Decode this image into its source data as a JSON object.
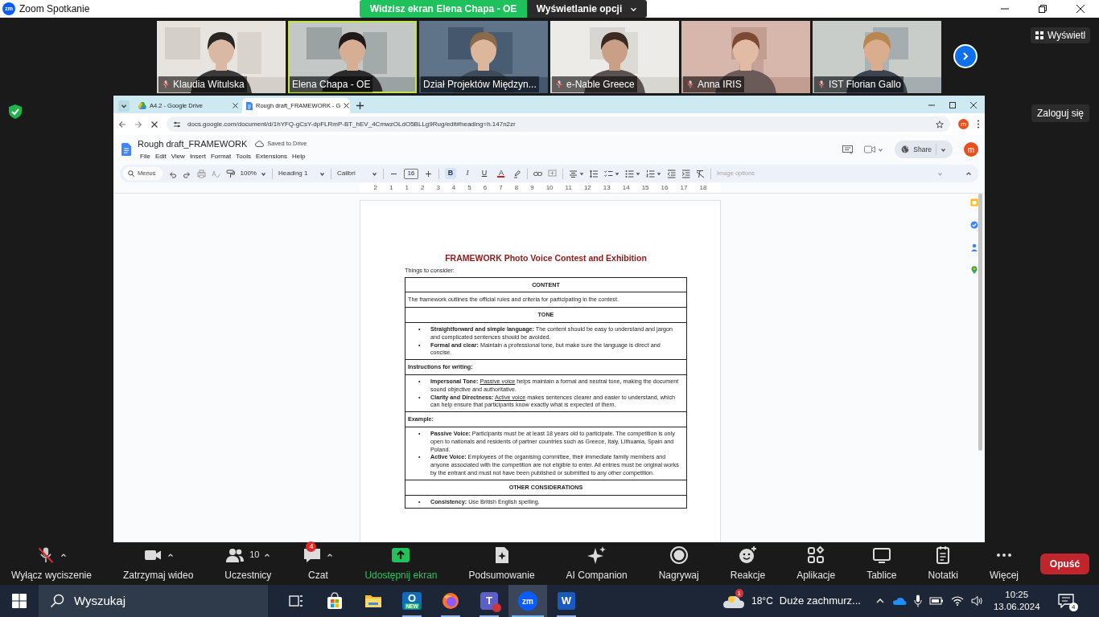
{
  "window": {
    "logo": "zm",
    "title": "Zoom Spotkanie"
  },
  "share_banner": {
    "status": "Widzisz ekran Elena Chapa - OE",
    "options": "Wyświetlanie opcji"
  },
  "participants": [
    {
      "name": "Klaudia Witulska",
      "muted": true,
      "active": false
    },
    {
      "name": "Elena Chapa - OE",
      "muted": false,
      "active": true
    },
    {
      "name": "Dział Projektów Międzyn...",
      "muted": false,
      "active": false
    },
    {
      "name": "e-Nable Greece",
      "muted": true,
      "active": false
    },
    {
      "name": "Anna IRIS",
      "muted": true,
      "active": false
    },
    {
      "name": "IST Florian Gallo",
      "muted": true,
      "active": false
    }
  ],
  "view_button": "Wyświetl",
  "sign_in_button": "Zaloguj się",
  "browser": {
    "tabs": [
      {
        "title": "A4.2 - Google Drive",
        "kind": "drive",
        "selected": false
      },
      {
        "title": "Rough draft_FRAMEWORK - G",
        "kind": "docs",
        "selected": true
      }
    ],
    "url": "docs.google.com/document/d/1hYFQ-gCsY-dpFLRmP-BT_hEV_4CmwzOLdO5BLLg9Rug/edit#heading=h.147n2zr",
    "profile": "m"
  },
  "docs": {
    "title": "Rough draft_FRAMEWORK",
    "status": "Saved to Drive",
    "menu": [
      "File",
      "Edit",
      "View",
      "Insert",
      "Format",
      "Tools",
      "Extensions",
      "Help"
    ],
    "share": "Share",
    "avatar": "m",
    "toolbar": {
      "search": "Menus",
      "zoom": "100%",
      "style": "Heading 1",
      "font": "Calibri",
      "font_size": "16",
      "format": [
        {
          "label": "B",
          "selected": true
        },
        {
          "label": "I",
          "selected": false
        },
        {
          "label": "U",
          "selected": false
        }
      ],
      "text_color": "A",
      "image_options": "Image options"
    },
    "ruler": [
      "2",
      "1",
      "1",
      "2",
      "3",
      "4",
      "5",
      "6",
      "7",
      "8",
      "9",
      "10",
      "11",
      "12",
      "13",
      "14",
      "15",
      "16",
      "17",
      "18"
    ]
  },
  "document": {
    "heading": "FRAMEWORK Photo Voice Contest and Exhibition",
    "intro": "Things to consider:",
    "rows": [
      {
        "kind": "header",
        "text": "CONTENT"
      },
      {
        "kind": "text",
        "text": "The framework outlines the official rules and criteria for participating in the contest."
      },
      {
        "kind": "header",
        "text": "TONE"
      },
      {
        "kind": "bullets",
        "marker": "•",
        "items": [
          {
            "term": "Straightforward and simple language:",
            "text": "The content should be easy to understand and jargon and complicated sentences should be avoided."
          },
          {
            "term": "Formal and clear:",
            "text": "Maintain a professional tone, but make sure the language is direct and concise."
          }
        ]
      },
      {
        "kind": "label",
        "text": "Instructions for writing:"
      },
      {
        "kind": "bullets",
        "marker": "•",
        "items": [
          {
            "term": "Impersonal Tone:",
            "underlined": "Passive voice",
            "text": "helps maintain a formal and neutral tone, making the document sound objective and authoritative."
          },
          {
            "term": "Clarity and Directness:",
            "underlined": "Active voice",
            "text": "makes sentences clearer and easier to understand, which can help ensure that participants know exactly what is expected of them."
          }
        ]
      },
      {
        "kind": "label",
        "text": "Example:"
      },
      {
        "kind": "bullets",
        "marker": "•",
        "items": [
          {
            "term": "Passive Voice:",
            "text": "Participants must be at least 18 years old to participate. The competition is only open to nationals and residents of partner countries such as Greece, Italy, Lithuania, Spain and Poland."
          },
          {
            "term": "Active Voice:",
            "text": "Employees of the organising committee, their immediate family members and anyone associated with the competition are not eligible to enter. All entries must be original works by the entrant and must not have been published or submitted to any other competition."
          }
        ]
      },
      {
        "kind": "header",
        "text": "OTHER CONSIDERATIONS"
      },
      {
        "kind": "bullets",
        "marker": "•",
        "items": [
          {
            "term": "Consistency:",
            "text": "Use British English spelling."
          }
        ]
      }
    ]
  },
  "meeting_controls": [
    {
      "kind": "mic",
      "label": "Wyłącz wyciszenie",
      "caret": true
    },
    {
      "kind": "video",
      "label": "Zatrzymaj wideo",
      "caret": true
    },
    {
      "kind": "participants",
      "label": "Uczestnicy",
      "count": "10",
      "caret": true
    },
    {
      "kind": "chat",
      "label": "Czat",
      "badge": "4",
      "caret": true
    },
    {
      "kind": "share",
      "label": "Udostępnij ekran",
      "caret": false
    },
    {
      "kind": "summary",
      "label": "Podsumowanie",
      "caret": false
    },
    {
      "kind": "companion",
      "label": "AI Companion",
      "caret": false
    },
    {
      "kind": "record",
      "label": "Nagrywaj",
      "caret": false
    },
    {
      "kind": "reactions",
      "label": "Reakcje",
      "caret": false
    },
    {
      "kind": "apps",
      "label": "Aplikacje",
      "caret": false
    },
    {
      "kind": "whiteboards",
      "label": "Tablice",
      "caret": false
    },
    {
      "kind": "notes",
      "label": "Notatki",
      "caret": false
    },
    {
      "kind": "more",
      "label": "Więcej",
      "caret": false
    }
  ],
  "leave_button": "Opuść",
  "taskbar": {
    "search": "Wyszukaj",
    "apps": [
      {
        "kind": "taskview",
        "running": false,
        "selected": false
      },
      {
        "kind": "store",
        "running": false,
        "selected": false
      },
      {
        "kind": "explorer",
        "running": false,
        "selected": false
      },
      {
        "kind": "outlook",
        "label": "O",
        "tag": "NEW",
        "running": true,
        "selected": false
      },
      {
        "kind": "firefox",
        "running": true,
        "selected": false
      },
      {
        "kind": "teams",
        "label": "T",
        "running": true,
        "selected": false
      },
      {
        "kind": "zoom",
        "label": "zm",
        "running": true,
        "selected": true
      },
      {
        "kind": "word",
        "label": "W",
        "running": true,
        "selected": false
      }
    ],
    "weather": {
      "badge": "1",
      "temperature": "18°C",
      "condition": "Duże zachmurz..."
    },
    "time": "10:25",
    "date": "13.06.2024",
    "notifications": "4"
  }
}
